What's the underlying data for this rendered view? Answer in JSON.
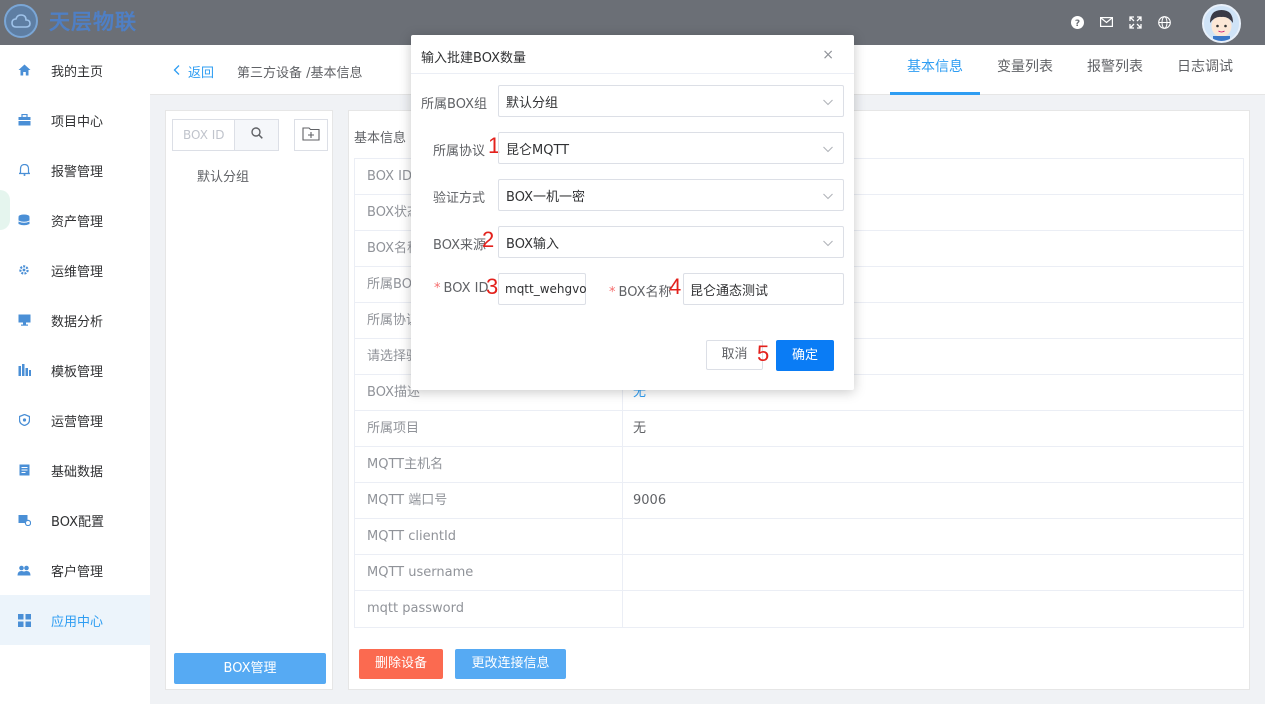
{
  "app": {
    "brand": "天层物联"
  },
  "sidebar": {
    "items": [
      {
        "label": "我的主页",
        "icon": "home-icon"
      },
      {
        "label": "项目中心",
        "icon": "briefcase-icon"
      },
      {
        "label": "报警管理",
        "icon": "bell-icon"
      },
      {
        "label": "资产管理",
        "icon": "database-icon"
      },
      {
        "label": "运维管理",
        "icon": "gear-icon"
      },
      {
        "label": "数据分析",
        "icon": "monitor-icon"
      },
      {
        "label": "模板管理",
        "icon": "bars-icon"
      },
      {
        "label": "运营管理",
        "icon": "shield-icon"
      },
      {
        "label": "基础数据",
        "icon": "document-icon"
      },
      {
        "label": "BOX配置",
        "icon": "box-config-icon"
      },
      {
        "label": "客户管理",
        "icon": "users-icon"
      },
      {
        "label": "应用中心",
        "icon": "grid-icon"
      }
    ],
    "active_index": 11
  },
  "header": {
    "back": "返回",
    "breadcrumb": "第三方设备 /基本信息",
    "tabs": [
      "基本信息",
      "变量列表",
      "报警列表",
      "日志调试"
    ]
  },
  "tree": {
    "search_placeholder": "BOX ID",
    "node": "默认分组",
    "manage_button": "BOX管理"
  },
  "main": {
    "title": "基本信息",
    "rows": [
      {
        "label": "BOX ID",
        "value": ""
      },
      {
        "label": "BOX状态",
        "value": ""
      },
      {
        "label": "BOX名称",
        "value": ""
      },
      {
        "label": "所属BOX组",
        "value": ""
      },
      {
        "label": "所属协议",
        "value": ""
      },
      {
        "label": "请选择验证方式",
        "value": ""
      },
      {
        "label": "BOX描述",
        "value": "无"
      },
      {
        "label": "所属项目",
        "value": "无"
      },
      {
        "label": "MQTT主机名",
        "value": ""
      },
      {
        "label": "MQTT 端口号",
        "value": "9006"
      },
      {
        "label": "MQTT clientId",
        "value": ""
      },
      {
        "label": "MQTT username",
        "value": ""
      },
      {
        "label": "mqtt password",
        "value": ""
      }
    ],
    "delete_button": "删除设备",
    "change_button": "更改连接信息"
  },
  "dialog": {
    "title": "输入批建BOX数量",
    "close": "×",
    "group_label": "所属BOX组",
    "group_value": "默认分组",
    "protocol_label": "所属协议",
    "protocol_value": "昆仑MQTT",
    "auth_label": "验证方式",
    "auth_value": "BOX一机一密",
    "source_label": "BOX来源",
    "source_value": "BOX输入",
    "boxid_label": "BOX ID",
    "boxid_value": "mqtt_wehgvo",
    "boxname_label": "BOX名称",
    "boxname_value": "昆仑通态测试",
    "required_mark": "*",
    "cancel": "取消",
    "ok": "确定",
    "annotations": [
      "1",
      "2",
      "3",
      "4",
      "5"
    ]
  },
  "colors": {
    "accent": "#2e9df2",
    "primary_button": "#0a7cf5",
    "danger": "#fb6a50",
    "annotation": "#e3211c"
  }
}
